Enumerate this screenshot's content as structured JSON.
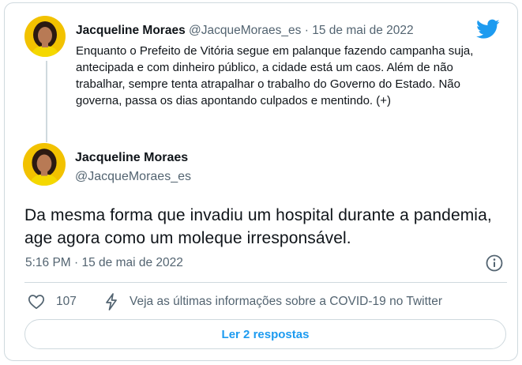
{
  "quoted_tweet": {
    "author_name": "Jacqueline Moraes",
    "author_handle": "@JacqueMoraes_es",
    "separator": "·",
    "date": "15 de mai de 2022",
    "text": "Enquanto o Prefeito de Vitória segue em palanque fazendo campanha suja, antecipada e com dinheiro público, a cidade está um caos. Além de não trabalhar, sempre tenta atrapalhar o trabalho do Governo do Estado. Não governa, passa os dias apontando culpados e mentindo. (+)"
  },
  "main_tweet": {
    "author_name": "Jacqueline Moraes",
    "author_handle": "@JacqueMoraes_es",
    "text": "Da mesma forma que invadiu um hospital durante a pandemia, age agora como um moleque irresponsável.",
    "timestamp": "5:16 PM · 15 de mai de 2022"
  },
  "actions": {
    "like_count": "107",
    "covid_info_text": "Veja as últimas informações sobre a COVID-19 no Twitter",
    "replies_button": "Ler 2 respostas"
  },
  "icons": {
    "brand": "twitter-bird-icon",
    "info": "info-icon",
    "like": "heart-icon",
    "covid": "lightning-bolt-icon"
  },
  "colors": {
    "brand_blue": "#1d9bf0",
    "secondary_text": "#536471",
    "border": "#cfd9de",
    "avatar_bg": "#f2c200"
  }
}
